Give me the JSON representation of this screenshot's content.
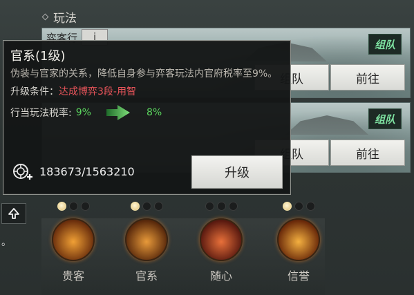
{
  "panel": {
    "title": "玩法",
    "card1": {
      "name": "弈客行",
      "info_label": "i",
      "team_badge": "组队",
      "team_button": "组队",
      "go_button": "前往"
    },
    "card2": {
      "team_badge": "组队",
      "team_button": "组队",
      "go_button": "前往"
    }
  },
  "tooltip": {
    "title": "官系(1级)",
    "description": "伪装与官家的关系，降低自身参与弈客玩法内官府税率至9%。",
    "condition_label": "升级条件：",
    "condition_value": "达成博弈3段-用智",
    "tax_label": "行当玩法税率:",
    "tax_from": "9%",
    "tax_to": "8%",
    "resource_value": "183673/1563210",
    "upgrade_button": "升级"
  },
  "left": {
    "marker": "。"
  },
  "skills": [
    {
      "name": "贵客",
      "dots": [
        true,
        false,
        false
      ],
      "colors": [
        "#6b2f0d",
        "#f0a035"
      ]
    },
    {
      "name": "官系",
      "dots": [
        true,
        false,
        false
      ],
      "colors": [
        "#5a2a0c",
        "#e89a3a"
      ]
    },
    {
      "name": "随心",
      "dots": [
        false,
        false,
        false
      ],
      "colors": [
        "#5a1a10",
        "#e8703a"
      ]
    },
    {
      "name": "信誉",
      "dots": [
        true,
        false,
        false
      ],
      "colors": [
        "#6a2a0a",
        "#f4b040"
      ]
    }
  ]
}
